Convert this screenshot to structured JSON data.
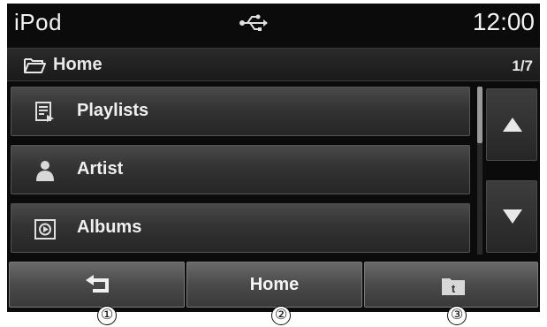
{
  "status_bar": {
    "title": "iPod",
    "usb_icon": "usb-icon",
    "clock": "12:00"
  },
  "folder_bar": {
    "folder_icon": "folder-icon",
    "name": "Home",
    "page": "1/7"
  },
  "list": {
    "items": [
      {
        "label": "Playlists",
        "icon": "playlist-icon"
      },
      {
        "label": "Artist",
        "icon": "artist-icon"
      },
      {
        "label": "Albums",
        "icon": "album-icon"
      }
    ],
    "scroll_up_icon": "triangle-up-icon",
    "scroll_down_icon": "triangle-down-icon"
  },
  "bottom_bar": {
    "back_icon": "back-arrow-icon",
    "home_label": "Home",
    "folder_up_icon": "folder-up-icon"
  },
  "callouts": [
    "①",
    "②",
    "③"
  ],
  "colors": {
    "background": "#0b0b0b",
    "text": "#f0f0f0",
    "button_gradient_top": "#6a6a6a"
  }
}
